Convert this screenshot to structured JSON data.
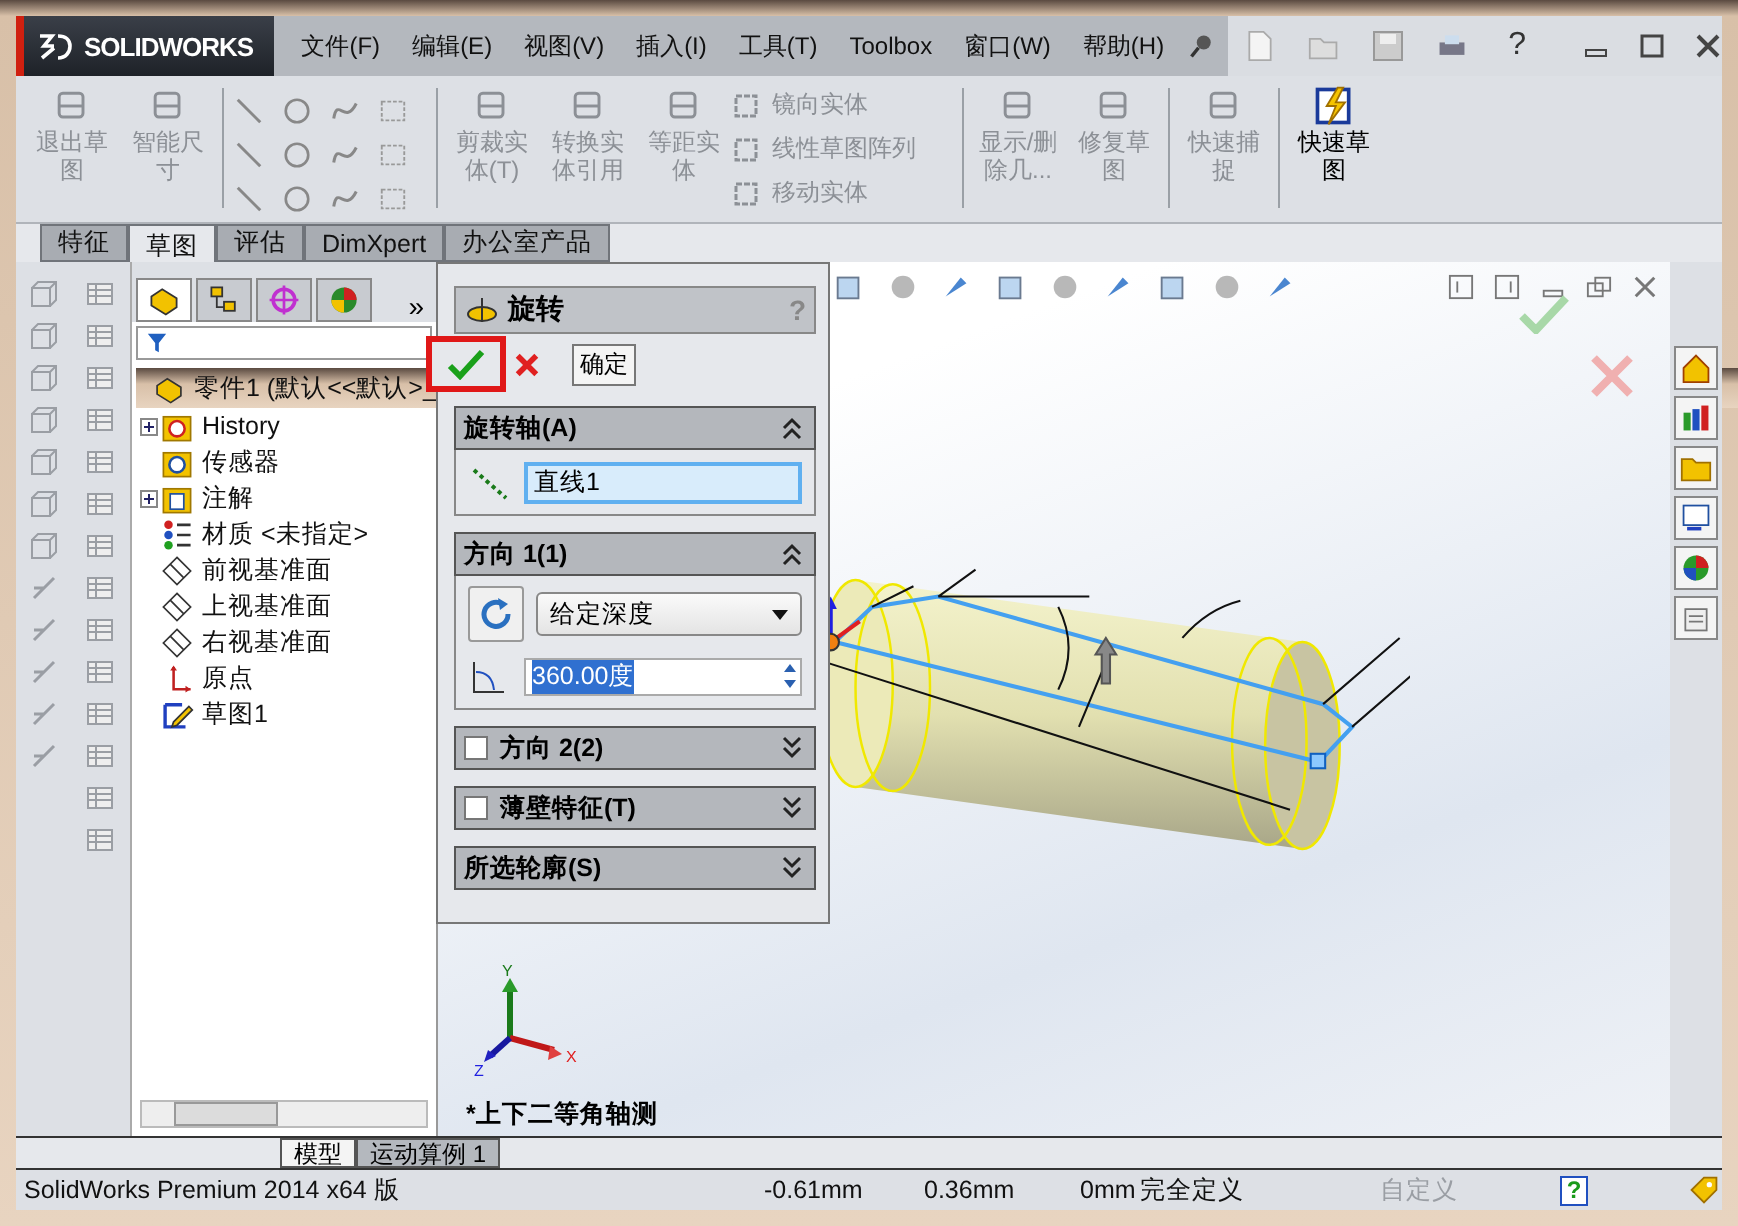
{
  "app": {
    "logo": "SOLIDWORKS"
  },
  "menu": [
    "文件(F)",
    "编辑(E)",
    "视图(V)",
    "插入(I)",
    "工具(T)",
    "Toolbox",
    "窗口(W)",
    "帮助(H)"
  ],
  "quick_access": {
    "help": "?"
  },
  "ribbon": [
    {
      "kind": "large",
      "label": "退出草图",
      "disabled": true
    },
    {
      "kind": "large",
      "label": "智能尺寸",
      "disabled": true
    },
    {
      "kind": "separator"
    },
    {
      "kind": "grid"
    },
    {
      "kind": "separator"
    },
    {
      "kind": "large",
      "label": "剪裁实体(T)",
      "disabled": true
    },
    {
      "kind": "large",
      "label": "转换实体引用",
      "disabled": true
    },
    {
      "kind": "large",
      "label": "等距实体",
      "disabled": true
    },
    {
      "kind": "list",
      "items": [
        {
          "label": "镜向实体",
          "disabled": true
        },
        {
          "label": "线性草图阵列",
          "disabled": true
        },
        {
          "label": "移动实体",
          "disabled": true
        }
      ]
    },
    {
      "kind": "separator"
    },
    {
      "kind": "large",
      "label": "显示/删除几...",
      "disabled": true
    },
    {
      "kind": "large",
      "label": "修复草图",
      "disabled": true
    },
    {
      "kind": "separator"
    },
    {
      "kind": "large",
      "label": "快速捕捉",
      "disabled": true
    },
    {
      "kind": "separator"
    },
    {
      "kind": "large",
      "label": "快速草图",
      "disabled": false
    }
  ],
  "tabs": [
    {
      "label": "特征",
      "selected": false
    },
    {
      "label": "草图",
      "selected": true
    },
    {
      "label": "评估",
      "selected": false
    },
    {
      "label": "DimXpert",
      "selected": false
    },
    {
      "label": "办公室产品",
      "selected": false
    }
  ],
  "feature_manager": {
    "more": "»",
    "root": "零件1  (默认<<默认>_",
    "items": [
      {
        "kind": "history",
        "label": "History",
        "collapsed": true
      },
      {
        "kind": "sensor",
        "label": "传感器",
        "collapsed": false
      },
      {
        "kind": "annotation",
        "label": "注解",
        "collapsed": true
      },
      {
        "kind": "material",
        "label": "材质 <未指定>",
        "collapsed": false
      },
      {
        "kind": "plane",
        "label": "前视基准面",
        "collapsed": false
      },
      {
        "kind": "plane",
        "label": "上视基准面",
        "collapsed": false
      },
      {
        "kind": "plane",
        "label": "右视基准面",
        "collapsed": false
      },
      {
        "kind": "origin",
        "label": "原点",
        "collapsed": false
      },
      {
        "kind": "sketch",
        "label": "草图1",
        "collapsed": false
      }
    ]
  },
  "property_manager": {
    "title": "旋转",
    "help": "?",
    "tooltip": "确定",
    "sections": [
      {
        "kind": "axis",
        "title": "旋转轴(A)",
        "expanded": true,
        "value": "直线1"
      },
      {
        "kind": "direction",
        "title": "方向 1(1)",
        "expanded": true,
        "type": "给定深度",
        "angle": "360.00度"
      },
      {
        "kind": "toggle",
        "title": "方向 2(2)",
        "expanded": false,
        "checked": false
      },
      {
        "kind": "toggle",
        "title": "薄壁特征(T)",
        "expanded": false,
        "checked": false
      },
      {
        "kind": "plain",
        "title": "所选轮廓(S)",
        "expanded": false
      }
    ]
  },
  "viewport": {
    "view_name": "*上下二等角轴测",
    "axes": {
      "y": "Y",
      "x": "X",
      "z": "Z"
    }
  },
  "bottom_tabs": [
    {
      "label": "模型",
      "selected": true
    },
    {
      "label": "运动算例 1",
      "selected": false
    }
  ],
  "status_bar": {
    "product": "SolidWorks Premium 2014 x64 版",
    "x": "-0.61mm",
    "y": "0.36mm",
    "z": "0mm",
    "state": "完全定义",
    "units": "自定义",
    "help": "?"
  }
}
